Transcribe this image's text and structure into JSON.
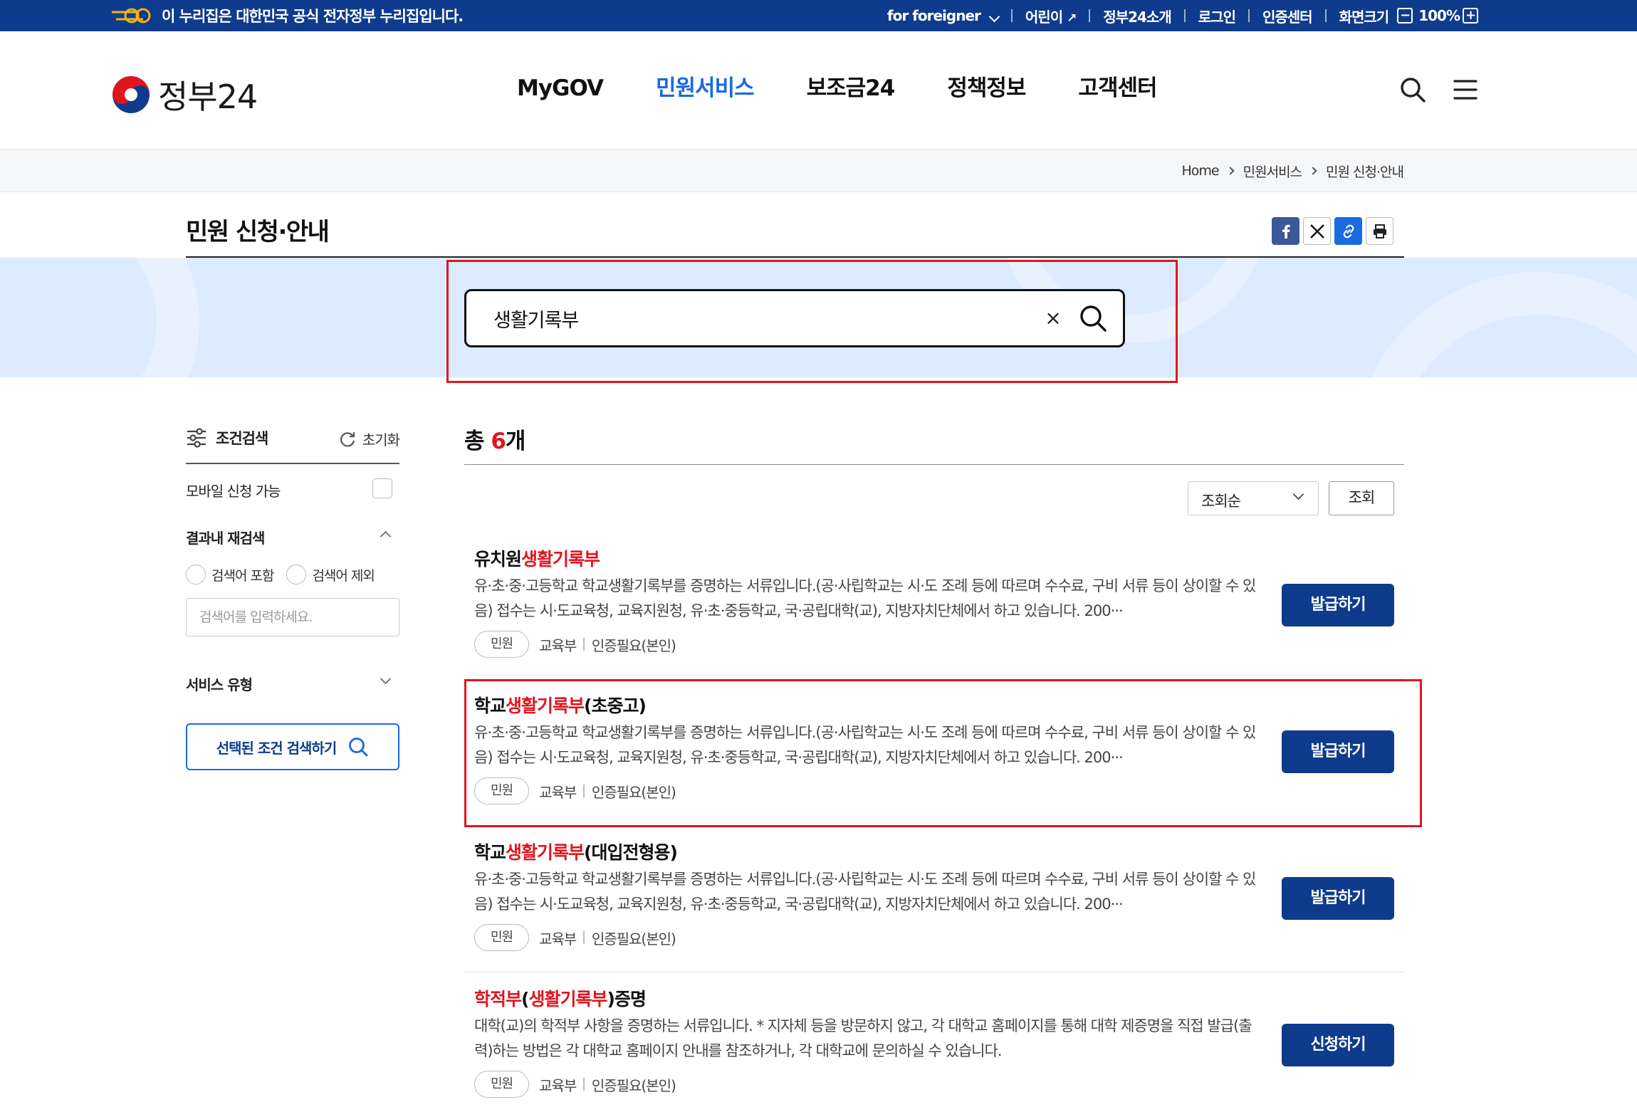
{
  "gov_bar": {
    "notice": "이 누리집은 대한민국 공식 전자정부 누리집입니다.",
    "foreigner": "for foreigner",
    "kids": "어린이",
    "intro": "정부24소개",
    "login": "로그인",
    "cert": "인증센터",
    "zoom_label": "화면크기",
    "zoom_minus": "−",
    "zoom_value": "100%",
    "zoom_plus": "+"
  },
  "header": {
    "logo_text": "정부24",
    "nav": [
      "MyGOV",
      "민원서비스",
      "보조금24",
      "정책정보",
      "고객센터"
    ],
    "active_nav_index": 1
  },
  "breadcrumb": [
    "Home",
    "민원서비스",
    "민원 신청·안내"
  ],
  "page": {
    "title": "민원 신청·안내"
  },
  "search": {
    "value": "생활기록부",
    "clear_glyph": "×"
  },
  "sidebar": {
    "condition_title": "조건검색",
    "reset_label": "초기화",
    "mobile_label": "모바일 신청 가능",
    "refine_title": "결과내 재검색",
    "include_label": "검색어 포함",
    "exclude_label": "검색어 제외",
    "refine_placeholder": "검색어를 입력하세요.",
    "service_type_title": "서비스 유형",
    "search_button": "선택된 조건 검색하기"
  },
  "results": {
    "total_prefix": "총 ",
    "total_count": "6",
    "total_suffix": "개",
    "sort_value": "조회순",
    "query_button": "조회",
    "items": [
      {
        "title_pre": "유치원",
        "title_hl": "생활기록부",
        "title_post": "",
        "desc": "유·초·중·고등학교 학교생활기록부를 증명하는 서류입니다.(공·사립학교는 시·도 조례 등에 따르며 수수료, 구비 서류 등이 상이할 수 있음) 접수는 시·도교육청, 교육지원청, 유·초·중등학교, 국·공립대학(교), 지방자치단체에서 하고 있습니다. 200···",
        "tag": "민원",
        "agency": "교육부",
        "auth": "인증필요(본인)",
        "button": "발급하기"
      },
      {
        "title_pre": "학교",
        "title_hl": "생활기록부",
        "title_post": "(초중고)",
        "desc": "유·초·중·고등학교 학교생활기록부를 증명하는 서류입니다.(공·사립학교는 시·도 조례 등에 따르며 수수료, 구비 서류 등이 상이할 수 있음) 접수는 시·도교육청, 교육지원청, 유·초·중등학교, 국·공립대학(교), 지방자치단체에서 하고 있습니다. 200···",
        "tag": "민원",
        "agency": "교육부",
        "auth": "인증필요(본인)",
        "button": "발급하기"
      },
      {
        "title_pre": "학교",
        "title_hl": "생활기록부",
        "title_post": "(대입전형용)",
        "desc": "유·초·중·고등학교 학교생활기록부를 증명하는 서류입니다.(공·사립학교는 시·도 조례 등에 따르며 수수료, 구비 서류 등이 상이할 수 있음) 접수는 시·도교육청, 교육지원청, 유·초·중등학교, 국·공립대학(교), 지방자치단체에서 하고 있습니다. 200···",
        "tag": "민원",
        "agency": "교육부",
        "auth": "인증필요(본인)",
        "button": "발급하기"
      },
      {
        "title_a": "학적부",
        "title_b": "(",
        "title_c": "생활기록부",
        "title_d": ")",
        "title_e": "증명",
        "desc": "대학(교)의 학적부 사항을 증명하는 서류입니다. * 지자체 등을 방문하지 않고, 각 대학교 홈페이지를 통해 대학 제증명을 직접 발급(출력)하는 방법은 각 대학교 홈페이지 안내를 참조하거나, 각 대학교에 문의하실 수 있습니다.",
        "tag": "민원",
        "agency": "교육부",
        "auth": "인증필요(본인)",
        "button": "신청하기"
      }
    ]
  },
  "colors": {
    "gov_blue": "#0f3b8c",
    "accent_blue": "#1a6ae0",
    "highlight_red": "#e0161f",
    "search_band": "#dcebff"
  }
}
